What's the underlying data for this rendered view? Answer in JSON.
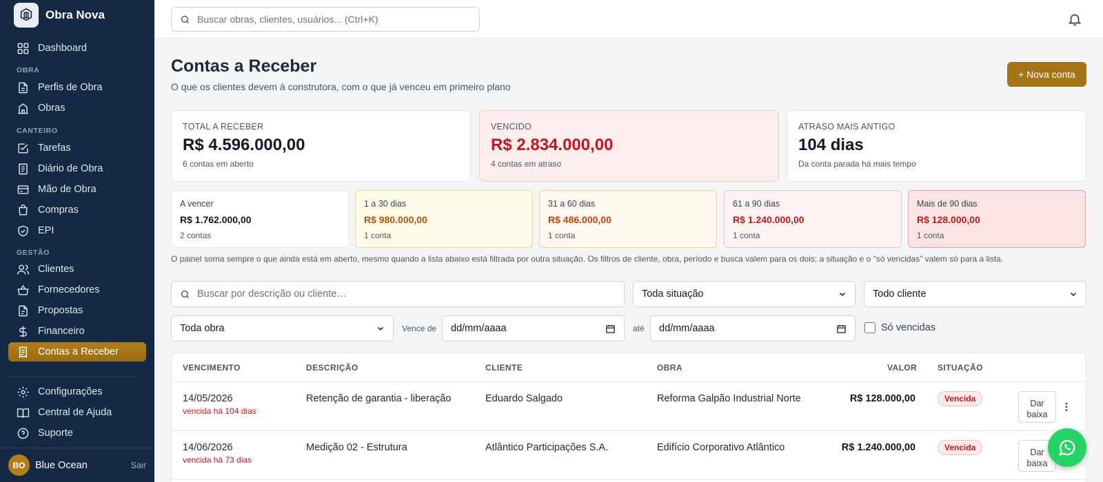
{
  "app": {
    "name": "Obra Nova"
  },
  "nav": {
    "dashboard": "Dashboard",
    "sections": {
      "obra": "OBRA",
      "canteiro": "CANTEIRO",
      "gestao": "GESTÃO"
    },
    "items": {
      "perfis": "Perfis de Obra",
      "obras": "Obras",
      "tarefas": "Tarefas",
      "diario": "Diário de Obra",
      "mao": "Mão de Obra",
      "compras": "Compras",
      "epi": "EPI",
      "clientes": "Clientes",
      "fornecedores": "Fornecedores",
      "propostas": "Propostas",
      "financeiro": "Financeiro",
      "contas": "Contas a Receber",
      "config": "Configurações",
      "ajuda": "Central de Ajuda",
      "suporte": "Suporte"
    }
  },
  "user": {
    "initials": "BO",
    "name": "Blue Ocean",
    "logout": "Sair"
  },
  "topbar": {
    "search_placeholder": "Buscar obras, clientes, usuários... (Ctrl+K)"
  },
  "page": {
    "title": "Contas a Receber",
    "subtitle": "O que os clientes devem à construtora, com o que já venceu em primeiro plano",
    "new_button": "+ Nova conta"
  },
  "kpis": [
    {
      "label": "TOTAL A RECEBER",
      "value": "R$ 4.596.000,00",
      "note": "6 contas em aberto"
    },
    {
      "label": "VENCIDO",
      "value": "R$ 2.834.000,00",
      "note": "4 contas em atraso"
    },
    {
      "label": "ATRASO MAIS ANTIGO",
      "value": "104 dias",
      "note": "Da conta parada há mais tempo"
    }
  ],
  "aging": [
    {
      "label": "A vencer",
      "value": "R$ 1.762.000,00",
      "count": "2 contas"
    },
    {
      "label": "1 a 30 dias",
      "value": "R$ 980.000,00",
      "count": "1 conta"
    },
    {
      "label": "31 a 60 dias",
      "value": "R$ 486.000,00",
      "count": "1 conta"
    },
    {
      "label": "61 a 90 dias",
      "value": "R$ 1.240.000,00",
      "count": "1 conta"
    },
    {
      "label": "Mais de 90 dias",
      "value": "R$ 128.000,00",
      "count": "1 conta"
    }
  ],
  "panel_note": "O painel soma sempre o que ainda está em aberto, mesmo quando a lista abaixo está filtrada por outra situação. Os filtros de cliente, obra, período e busca valem para os dois; a situação e o \"só vencidas\" valem só para a lista.",
  "filters": {
    "search_placeholder": "Buscar por descrição ou cliente…",
    "situacao": "Toda situação",
    "cliente": "Todo cliente",
    "obra": "Toda obra",
    "vence_de_label": "Vence de",
    "date_from": "dd/mm/aaaa",
    "ate_label": "até",
    "date_to": "dd/mm/aaaa",
    "so_vencidas": "Só vencidas"
  },
  "table": {
    "headers": {
      "vencimento": "VENCIMENTO",
      "descricao": "DESCRIÇÃO",
      "cliente": "CLIENTE",
      "obra": "OBRA",
      "valor": "VALOR",
      "situacao": "SITUAÇÃO"
    },
    "rows": [
      {
        "due": "14/05/2026",
        "due_note": "vencida há 104 dias",
        "description": "Retenção de garantia - liberação",
        "client": "Eduardo Salgado",
        "project": "Reforma Galpão Industrial Norte",
        "value": "R$ 128.000,00",
        "status": "Vencida",
        "action": "Dar baixa"
      },
      {
        "due": "14/06/2026",
        "due_note": "vencida há 73 dias",
        "description": "Medição 02 - Estrutura",
        "client": "Atlântico Participações S.A.",
        "project": "Edifício Corporativo Atlântico",
        "value": "R$ 1.240.000,00",
        "status": "Vencida",
        "action": "Dar baixa"
      }
    ]
  },
  "colors": {
    "sidebar": "#142943",
    "accent": "#a47417",
    "danger": "#c0161e",
    "whatsapp": "#25d366"
  }
}
